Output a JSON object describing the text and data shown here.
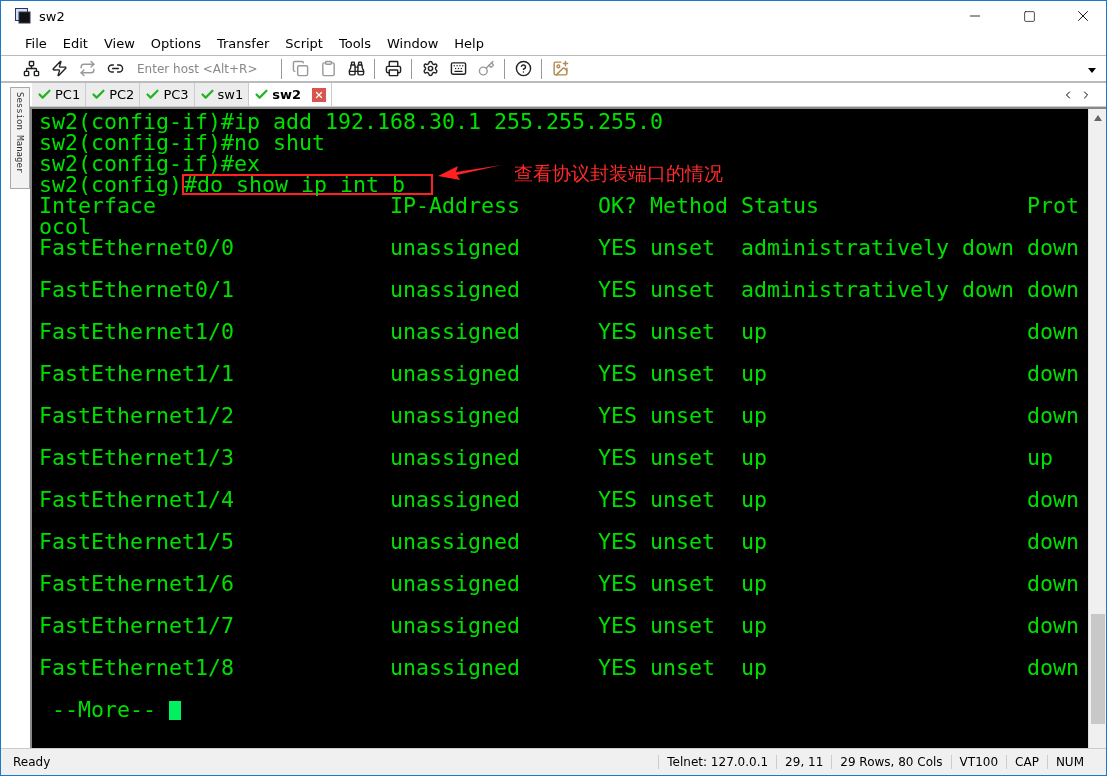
{
  "window": {
    "title": "sw2"
  },
  "menu": [
    "File",
    "Edit",
    "View",
    "Options",
    "Transfer",
    "Script",
    "Tools",
    "Window",
    "Help"
  ],
  "toolbar": {
    "host_field": {
      "placeholder": "Enter host <Alt+R>"
    }
  },
  "tabs": [
    {
      "label": "PC1",
      "selected": false
    },
    {
      "label": "PC2",
      "selected": false
    },
    {
      "label": "PC3",
      "selected": false
    },
    {
      "label": "sw1",
      "selected": false
    },
    {
      "label": "sw2",
      "selected": true
    }
  ],
  "session_manager": {
    "label": "Session Manager"
  },
  "terminal": {
    "lines": [
      {
        "kind": "text",
        "text": "sw2(config-if)#ip add 192.168.30.1 255.255.255.0"
      },
      {
        "kind": "text",
        "text": "sw2(config-if)#no shut"
      },
      {
        "kind": "text",
        "text": "sw2(config-if)#ex"
      },
      {
        "kind": "marked",
        "prompt": "sw2(config)",
        "command": "#do show ip int b"
      },
      {
        "kind": "text",
        "text": "Interface                  IP-Address      OK? Method Status                Prot"
      },
      {
        "kind": "text",
        "text": "ocol"
      },
      {
        "kind": "row",
        "text": "FastEthernet0/0            unassigned      YES unset  administratively down down"
      },
      {
        "kind": "row",
        "text": "FastEthernet0/1            unassigned      YES unset  administratively down down"
      },
      {
        "kind": "row",
        "text": "FastEthernet1/0            unassigned      YES unset  up                    down"
      },
      {
        "kind": "row",
        "text": "FastEthernet1/1            unassigned      YES unset  up                    down"
      },
      {
        "kind": "row",
        "text": "FastEthernet1/2            unassigned      YES unset  up                    down"
      },
      {
        "kind": "row",
        "text": "FastEthernet1/3            unassigned      YES unset  up                    up"
      },
      {
        "kind": "row",
        "text": "FastEthernet1/4            unassigned      YES unset  up                    down"
      },
      {
        "kind": "row",
        "text": "FastEthernet1/5            unassigned      YES unset  up                    down"
      },
      {
        "kind": "row",
        "text": "FastEthernet1/6            unassigned      YES unset  up                    down"
      },
      {
        "kind": "row",
        "text": "FastEthernet1/7            unassigned      YES unset  up                    down"
      },
      {
        "kind": "row",
        "text": "FastEthernet1/8            unassigned      YES unset  up                    down"
      },
      {
        "kind": "pager",
        "text": " --More-- "
      }
    ],
    "annotation": "查看协议封装端口的情况"
  },
  "status_bar": [
    "Ready",
    "Telnet: 127.0.0.1",
    "29,  11",
    "29 Rows, 80 Cols",
    "VT100",
    "CAP",
    "NUM"
  ]
}
